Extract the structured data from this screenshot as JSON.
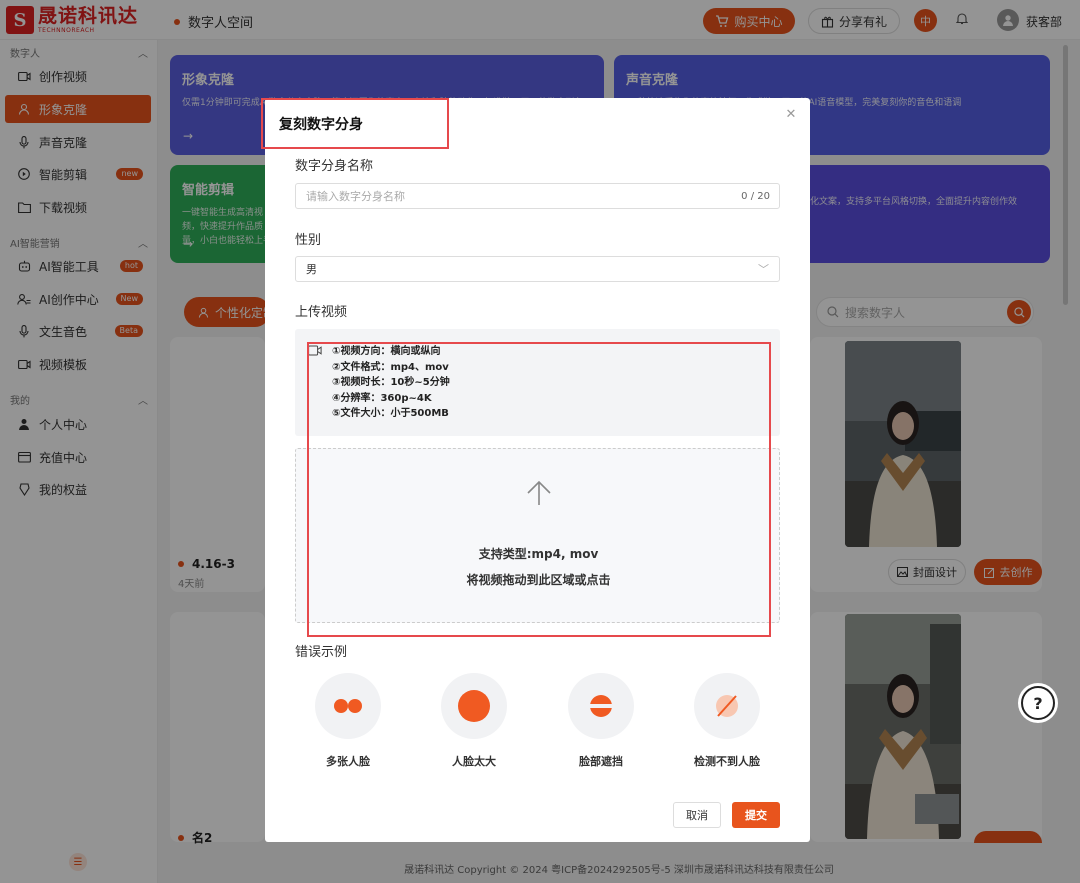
{
  "header": {
    "logo_text": "晟诺科讯达",
    "logo_en": "TECHNNOREACH",
    "logo_mark": "S",
    "space_title": "数字人空间",
    "buy_label": "购买中心",
    "share_label": "分享有礼",
    "lang_label": "中",
    "user_name": "获客部"
  },
  "sidebar": {
    "groups": [
      {
        "label": "数字人"
      },
      {
        "label": "AI智能营销"
      },
      {
        "label": "我的"
      }
    ],
    "items": [
      {
        "label": "创作视频",
        "icon": "video-icon"
      },
      {
        "label": "形象克隆",
        "icon": "user-icon",
        "active": true
      },
      {
        "label": "声音克隆",
        "icon": "mic-icon"
      },
      {
        "label": "智能剪辑",
        "icon": "play-circle-icon",
        "badge": "new"
      },
      {
        "label": "下载视频",
        "icon": "folder-icon"
      },
      {
        "label": "AI智能工具",
        "icon": "robot-icon",
        "badge": "hot"
      },
      {
        "label": "AI创作中心",
        "icon": "users-icon",
        "badge": "New"
      },
      {
        "label": "文生音色",
        "icon": "mic-icon",
        "badge": "Beta"
      },
      {
        "label": "视频模板",
        "icon": "video-icon"
      },
      {
        "label": "个人中心",
        "icon": "person-icon"
      },
      {
        "label": "充值中心",
        "icon": "wallet-icon"
      },
      {
        "label": "我的权益",
        "icon": "badge-icon"
      }
    ]
  },
  "cards": [
    {
      "title": "形象克隆",
      "desc": "仅需1分钟即可完成AI数字分身克隆，等度还原你的声音、表情和肢体动作，打造独一无二的数字形象",
      "color": "#5b5fe0"
    },
    {
      "title": "声音克隆",
      "desc": "60秒快速采集你的声纹特征，生成独一无二的AI语音模型，完美复刻你的音色和语调",
      "color": "#5560e6"
    },
    {
      "title": "智能剪辑",
      "desc": "一键智能生成高清视频，快速提升作品质量，小白也能轻松上手",
      "color": "#2fb05a"
    },
    {
      "title": "",
      "desc": "化文案，支持多平台风格切换，全面提升内容创作效",
      "color": "#5a4fe0"
    }
  ],
  "main": {
    "pill_label": "个性化定制",
    "search_placeholder": "搜索数字人",
    "project1_name": "4.16-3",
    "project1_time": "4天前",
    "project2_name": "名2",
    "cover_label": "封面设计",
    "create_label": "去创作"
  },
  "footer": {
    "text": "晟诺科讯达   Copyright © 2024 粤ICP备2024292505号-5 深圳市晟诺科讯达科技有限责任公司"
  },
  "modal": {
    "title": "复刻数字分身",
    "name_label": "数字分身名称",
    "name_placeholder": "请输入数字分身名称",
    "name_count": "0 / 20",
    "gender_label": "性别",
    "gender_value": "男",
    "upload_label": "上传视频",
    "requirements": [
      "①视频方向：横向或纵向",
      "②文件格式：mp4、mov",
      "③视频时长：10秒~5分钟",
      "④分辨率：360p~4K",
      "⑤文件大小：小于500MB"
    ],
    "drop_types": "支持类型:mp4, mov",
    "drop_hint": "将视频拖动到此区域或点击",
    "errors_label": "错误示例",
    "errors": [
      {
        "label": "多张人脸"
      },
      {
        "label": "人脸太大"
      },
      {
        "label": "脸部遮挡"
      },
      {
        "label": "检测不到人脸"
      }
    ],
    "cancel_label": "取消",
    "submit_label": "提交"
  },
  "colors": {
    "accent": "#e8541d",
    "highlight": "#e6494c"
  }
}
